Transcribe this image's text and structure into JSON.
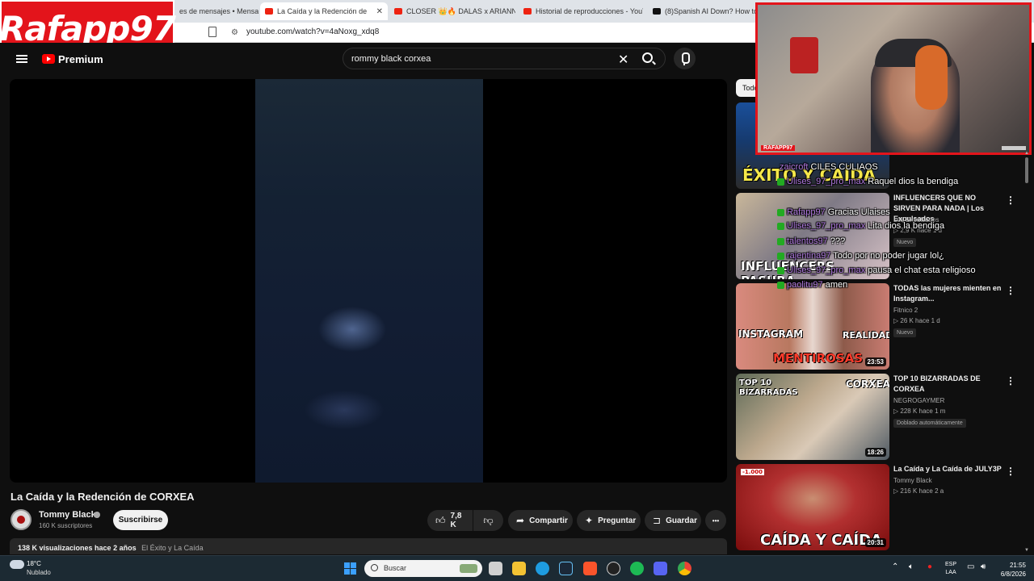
{
  "overlay": {
    "logo_text": "Rafapp97"
  },
  "browser": {
    "tabs": [
      {
        "label": "es de mensajes • Mensajes"
      },
      {
        "label": "La Caída y la Redención de",
        "close": "✕"
      },
      {
        "label": "CLOSER 👑🔥 DALAS x ARIANN 🐙"
      },
      {
        "label": "Historial de reproducciones - YouTube"
      },
      {
        "label": "(8)Spanish AI Down? How to C"
      }
    ],
    "url": "youtube.com/watch?v=4aNoxg_xdq8"
  },
  "yt": {
    "logo_label": "Premium",
    "search_query": "rommy black corxea",
    "clear": "✕"
  },
  "video": {
    "title": "La Caída y la Redención de CORXEA",
    "channel": "Tommy Black",
    "subscribers": "160 K suscriptores",
    "subscribe_label": "Suscribirse",
    "likes": "7,8 K",
    "share_label": "Compartir",
    "ask_label": "Preguntar",
    "save_label": "Guardar",
    "more": "•••",
    "views_date": "138 K visualizaciones  hace 2 años",
    "tags": "El Éxito y La Caída"
  },
  "sidebar": {
    "chip": "Todo",
    "recs": [
      {
        "title": "",
        "thumb_text": "ÉXITO Y CAÍDA"
      },
      {
        "title": "INFLUENCERS QUE NO SIRVEN PARA NADA | Los Expulsados",
        "channel": "Los Expulsados",
        "meta": "▷ 2,9 K  hace 1 d",
        "badge": "Nuevo",
        "thumb_text": "INFLUENCERS PASURA"
      },
      {
        "title": "TODAS las mujeres mienten en Instagram...",
        "channel": "Fitnico 2",
        "meta": "▷ 26 K  hace 1 d",
        "badge": "Nuevo",
        "duration": "23:53",
        "thumb_text_1": "INSTAGRAM",
        "thumb_text_2": "REALIDAD",
        "thumb_text_3": "MENTIROSAS"
      },
      {
        "title": "TOP 10 BIZARRADAS DE CORXEA",
        "channel": "NEGROGAYMER",
        "meta": "▷ 228 K  hace 1 m",
        "badge": "Doblado automáticamente",
        "duration": "18:26",
        "thumb_text_1": "TOP 10 BIZARRADAS",
        "thumb_text_2": "CORXEA"
      },
      {
        "title": "La Caída y La Caída de JULY3P",
        "channel": "Tommy Black",
        "meta": "▷ 216 K  hace 2 a",
        "duration": "20:31",
        "thumb_text": "CAÍDA Y CAÍDA",
        "thumb_small": "-1.000"
      }
    ]
  },
  "cam": {
    "label": "RAFAPP97"
  },
  "chat": [
    {
      "user": "zaicroft",
      "msg": "CILES CULIAOS"
    },
    {
      "user": "Ulises_97_pro_max",
      "msg": "Raquel dios la bendiga"
    },
    {
      "user": "Rafapp97",
      "msg": "Gracias Ulaises"
    },
    {
      "user": "Ulises_97_pro_max",
      "msg": "Lita dios la bendiga"
    },
    {
      "user": "talentos97",
      "msg": "???"
    },
    {
      "user": "rajentina97",
      "msg": "Todo por no poder jugar lol¿"
    },
    {
      "user": "Ulises_97_pro_max",
      "msg": "pausa el chat esta religioso"
    },
    {
      "user": "paolitu97",
      "msg": "amen"
    }
  ],
  "taskbar": {
    "temp": "18°C",
    "weather": "Nublado",
    "search_label": "Buscar",
    "lang1": "ESP",
    "lang2": "LAA",
    "time": "21:55",
    "date": "6/8/2026"
  }
}
